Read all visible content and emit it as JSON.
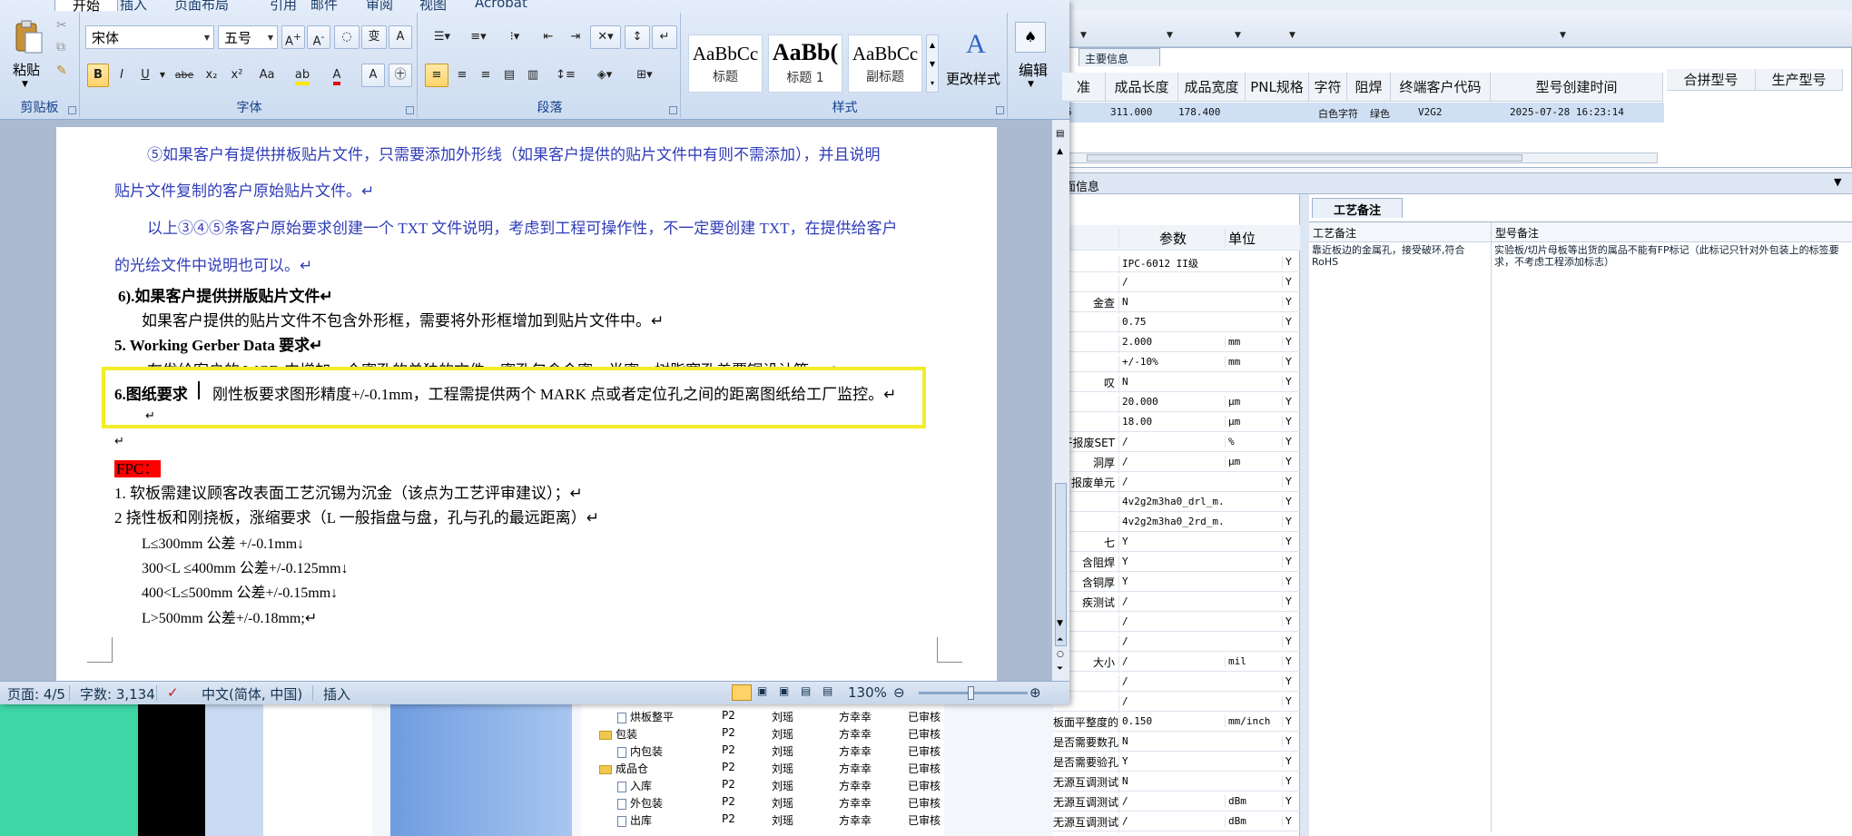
{
  "ribbon": {
    "tabs": [
      "开始",
      "插入",
      "页面布局",
      "引用",
      "邮件",
      "审阅",
      "视图",
      "Acrobat"
    ],
    "clipboard": {
      "paste": "粘贴",
      "label": "剪贴板"
    },
    "font": {
      "family": "宋体",
      "size": "五号",
      "label": "字体",
      "bold": "B",
      "italic": "I",
      "underline": "U",
      "strike": "abe",
      "sub": "x₂",
      "sup": "x²",
      "case": "Aa"
    },
    "paragraph": {
      "label": "段落"
    },
    "styles": {
      "label": "样式",
      "cards": [
        {
          "sample": "AaBbCc",
          "name": "标题"
        },
        {
          "sample": "AaBb(",
          "name": "标题 1"
        },
        {
          "sample": "AaBbCc",
          "name": "副标题"
        }
      ],
      "change_styles": "更改样式"
    },
    "editing": {
      "label": "编辑"
    }
  },
  "document": {
    "lines": {
      "l1": "⑤如果客户有提供拼板贴片文件，只需要添加外形线（如果客户提供的贴片文件中有则不需添加），并且说明",
      "l2": "贴片文件复制的客户原始贴片文件。↵",
      "l3": "以上③④⑤条客户原始要求创建一个 TXT 文件说明，考虑到工程可操作性，不一定要创建 TXT，在提供给客户",
      "l4": "的光绘文件中说明也可以。↵",
      "l5": "6).如果客户提供拼版贴片文件↵",
      "l6": "如果客户提供的贴片文件不包含外形框，需要将外形框增加到贴片文件中。↵",
      "l7": "5.    Working Gerber Data 要求↵",
      "l8": "在发给客户的 WGD 中增加一个蜜孔的单独的文件，蜜孔包含金蜜、半蜜、树脂塞孔盖覆铜设计等。↵",
      "l9a": "6.图纸要求",
      "l9b": "刚性板要求图形精度+/-0.1mm，工程需提供两个 MARK 点或者定位孔之间的距离图纸给工厂监控。↵",
      "l10": "↵",
      "l11": "↵",
      "l12": "FPC：",
      "l13": "1. 软板需建议顾客改表面工艺沉锡为沉金（该点为工艺评审建议）；↵",
      "l14": "2 挠性板和刚挠板，涨缩要求（L 一般指盘与盘，孔与孔的最远距离）↵",
      "l15": "L≤300mm  公差 +/-0.1mm↓",
      "l16": "300<L  ≤400mm  公差+/-0.125mm↓",
      "l17": "400<L≤500mm 公差+/-0.15mm↓",
      "l18": "L>500mm  公差+/-0.18mm;↵"
    }
  },
  "status": {
    "page": "页面: 4/5",
    "words": "字数: 3,134",
    "lang": "中文(简体, 中国)",
    "mode": "插入",
    "zoom": "130%"
  },
  "bgapp": {
    "main_info_tab": "主要信息",
    "upper_headers": [
      "准",
      "成品长度",
      "成品宽度",
      "PNL规格",
      "字符",
      "阻焊",
      "终端客户代码",
      "型号创建时间"
    ],
    "upper_headers2": [
      "合拼型号",
      "生产型号"
    ],
    "upper_row": {
      "c0": "5",
      "len": "311.000",
      "wid": "178.400",
      "char": "白色字符",
      "mask": "绿色",
      "code": "V2G2",
      "created": "2025-07-28 16:23:14"
    },
    "band_left": "面信息",
    "param_headers": {
      "param": "参数",
      "unit": "单位"
    },
    "params": [
      {
        "l": "",
        "v": "IPC-6012 II级",
        "u": "",
        "y": "Y"
      },
      {
        "l": "",
        "v": "/",
        "u": "",
        "y": "Y"
      },
      {
        "l": "金查",
        "v": "N",
        "u": "",
        "y": "Y"
      },
      {
        "l": "",
        "v": "0.75",
        "u": "",
        "y": "Y"
      },
      {
        "l": "",
        "v": "2.000",
        "u": "mm",
        "y": "Y"
      },
      {
        "l": "",
        "v": "+/-10%",
        "u": "mm",
        "y": "Y"
      },
      {
        "l": "叹",
        "v": "N",
        "u": "",
        "y": "Y"
      },
      {
        "l": "",
        "v": "20.000",
        "u": "μm",
        "y": "Y"
      },
      {
        "l": "",
        "v": "18.00",
        "u": "μm",
        "y": "Y"
      },
      {
        "l": "干报废SET",
        "v": "/",
        "u": "%",
        "y": "Y"
      },
      {
        "l": "洞厚",
        "v": "/",
        "u": "μm",
        "y": "Y"
      },
      {
        "l": "报废单元",
        "v": "/",
        "u": "",
        "y": "Y"
      },
      {
        "l": "",
        "v": "4v2g2m3ha0_drl_m...",
        "u": "",
        "y": "Y"
      },
      {
        "l": "",
        "v": "4v2g2m3ha0_2rd_m...",
        "u": "",
        "y": "Y"
      },
      {
        "l": "七",
        "v": "Y",
        "u": "",
        "y": "Y"
      },
      {
        "l": "含阻焊",
        "v": "Y",
        "u": "",
        "y": "Y"
      },
      {
        "l": "含铜厚",
        "v": "Y",
        "u": "",
        "y": "Y"
      },
      {
        "l": "疾测试",
        "v": "/",
        "u": "",
        "y": "Y"
      },
      {
        "l": "",
        "v": "/",
        "u": "",
        "y": "Y"
      },
      {
        "l": "",
        "v": "/",
        "u": "",
        "y": "Y"
      },
      {
        "l": "大小",
        "v": "/",
        "u": "mil",
        "y": "Y"
      },
      {
        "l": "",
        "v": "/",
        "u": "",
        "y": "Y"
      },
      {
        "l": "",
        "v": "/",
        "u": "",
        "y": "Y"
      },
      {
        "l": "板面平整度的最大极差",
        "v": "0.150",
        "u": "mm/inch",
        "y": "Y"
      },
      {
        "l": "是否需要数孔",
        "v": "N",
        "u": "",
        "y": "Y"
      },
      {
        "l": "是否需要验孔检查",
        "v": "Y",
        "u": "",
        "y": "Y"
      },
      {
        "l": "无源互调测试",
        "v": "N",
        "u": "",
        "y": "Y"
      },
      {
        "l": "无源互调测试功率",
        "v": "/",
        "u": "dBm",
        "y": "Y"
      },
      {
        "l": "无源互调测试标准",
        "v": "/",
        "u": "dBm",
        "y": "Y"
      }
    ],
    "notes_tab": "工艺备注",
    "notes_headers": [
      "工艺备注",
      "型号备注"
    ],
    "notes_text": [
      "靠近板边的金属孔，接受破环,符合RoHS",
      "实验板/切片母板等出货的属品不能有FP标记（此标记只针对外包装上的标签要求，不考虑工程添加标志）"
    ],
    "tree": [
      {
        "name": "烘板整平",
        "a": "P2",
        "b": "刘瑶",
        "c": "方幸幸",
        "d": "已审核",
        "type": "file",
        "indent": 40
      },
      {
        "name": "包装",
        "a": "P2",
        "b": "刘瑶",
        "c": "方幸幸",
        "d": "已审核",
        "type": "folder",
        "indent": 20
      },
      {
        "name": "内包装",
        "a": "P2",
        "b": "刘瑶",
        "c": "方幸幸",
        "d": "已审核",
        "type": "file",
        "indent": 40
      },
      {
        "name": "成品仓",
        "a": "P2",
        "b": "刘瑶",
        "c": "方幸幸",
        "d": "已审核",
        "type": "folder",
        "indent": 20
      },
      {
        "name": "入库",
        "a": "P2",
        "b": "刘瑶",
        "c": "方幸幸",
        "d": "已审核",
        "type": "file",
        "indent": 40
      },
      {
        "name": "外包装",
        "a": "P2",
        "b": "刘瑶",
        "c": "方幸幸",
        "d": "已审核",
        "type": "file",
        "indent": 40
      },
      {
        "name": "出库",
        "a": "P2",
        "b": "刘瑶",
        "c": "方幸幸",
        "d": "已审核",
        "type": "file",
        "indent": 40
      }
    ]
  }
}
